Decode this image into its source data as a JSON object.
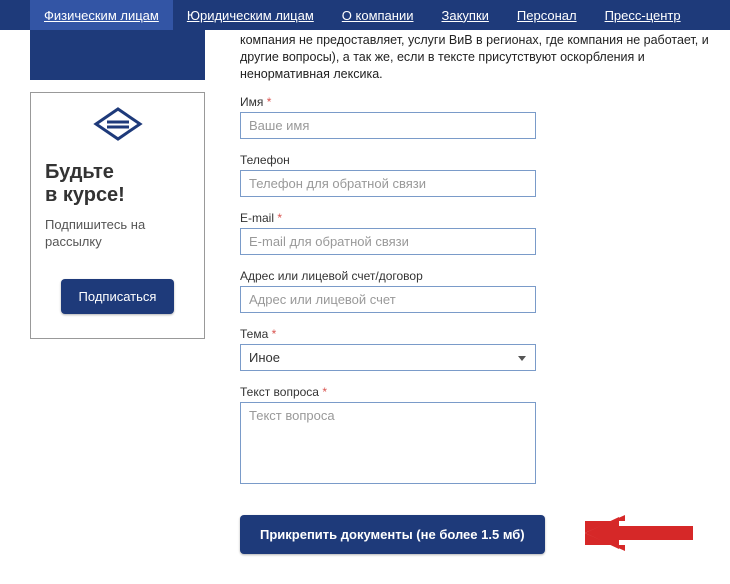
{
  "nav": {
    "items": [
      {
        "label": "Физическим лицам",
        "active": true
      },
      {
        "label": "Юридическим лицам",
        "active": false
      },
      {
        "label": "О компании",
        "active": false
      },
      {
        "label": "Закупки",
        "active": false
      },
      {
        "label": "Персонал",
        "active": false
      },
      {
        "label": "Пресс-центр",
        "active": false
      }
    ]
  },
  "subscribe": {
    "title_line1": "Будьте",
    "title_line2": "в курсе!",
    "text": "Подпишитесь на рассылку",
    "button": "Подписаться"
  },
  "form": {
    "disclaimer": "компания не предоставляет, услуги ВиВ в регионах, где компания не работает, и другие вопросы), а так же, если в тексте присутствуют оскорбления и ненормативная лексика.",
    "name_label": "Имя",
    "name_placeholder": "Ваше имя",
    "phone_label": "Телефон",
    "phone_placeholder": "Телефон для обратной связи",
    "email_label": "E-mail",
    "email_placeholder": "E-mail для обратной связи",
    "address_label": "Адрес или лицевой счет/договор",
    "address_placeholder": "Адрес или лицевой счет",
    "topic_label": "Тема",
    "topic_value": "Иное",
    "text_label": "Текст вопроса",
    "text_placeholder": "Текст вопроса",
    "attach_button": "Прикрепить документы (не более 1.5 мб)"
  }
}
